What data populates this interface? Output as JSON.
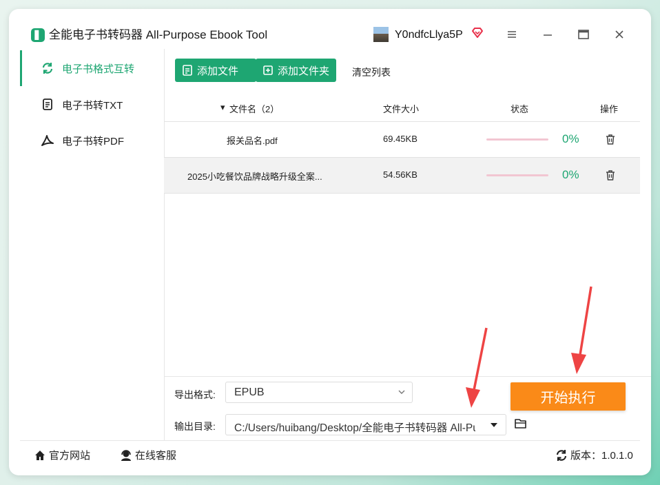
{
  "app": {
    "title": "全能电子书转码器 All-Purpose Ebook Tool",
    "logo_glyph": "▋",
    "username": "Y0ndfcLlya5P"
  },
  "sidebar": {
    "items": [
      {
        "label": "电子书格式互转",
        "icon": "refresh-icon",
        "active": true
      },
      {
        "label": "电子书转TXT",
        "icon": "document-icon",
        "active": false
      },
      {
        "label": "电子书转PDF",
        "icon": "pdf-icon",
        "active": false
      }
    ]
  },
  "toolbar": {
    "add_file": "添加文件",
    "add_folder": "添加文件夹",
    "clear_list": "清空列表"
  },
  "table": {
    "headers": {
      "sort_arrow": "▾",
      "filename": "文件名（2）",
      "size": "文件大小",
      "status": "状态",
      "action": "操作"
    },
    "rows": [
      {
        "name": "报关品名.pdf",
        "size": "69.45KB",
        "progress": 0,
        "percent": "0%"
      },
      {
        "name": "2025小吃餐饮品牌战略升级全案...",
        "size": "54.56KB",
        "progress": 0,
        "percent": "0%"
      }
    ]
  },
  "output": {
    "format_label": "导出格式:",
    "format_value": "EPUB",
    "dir_label": "输出目录:",
    "dir_value": "C:/Users/huibang/Desktop/全能电子书转码器 All-Pu"
  },
  "start_button": "开始执行",
  "footer": {
    "website": "官方网站",
    "support": "在线客服",
    "version": "版本：1.0.1.0"
  },
  "colors": {
    "accent": "#1ea672",
    "start": "#fa8a18",
    "arrow": "#ee4444"
  }
}
